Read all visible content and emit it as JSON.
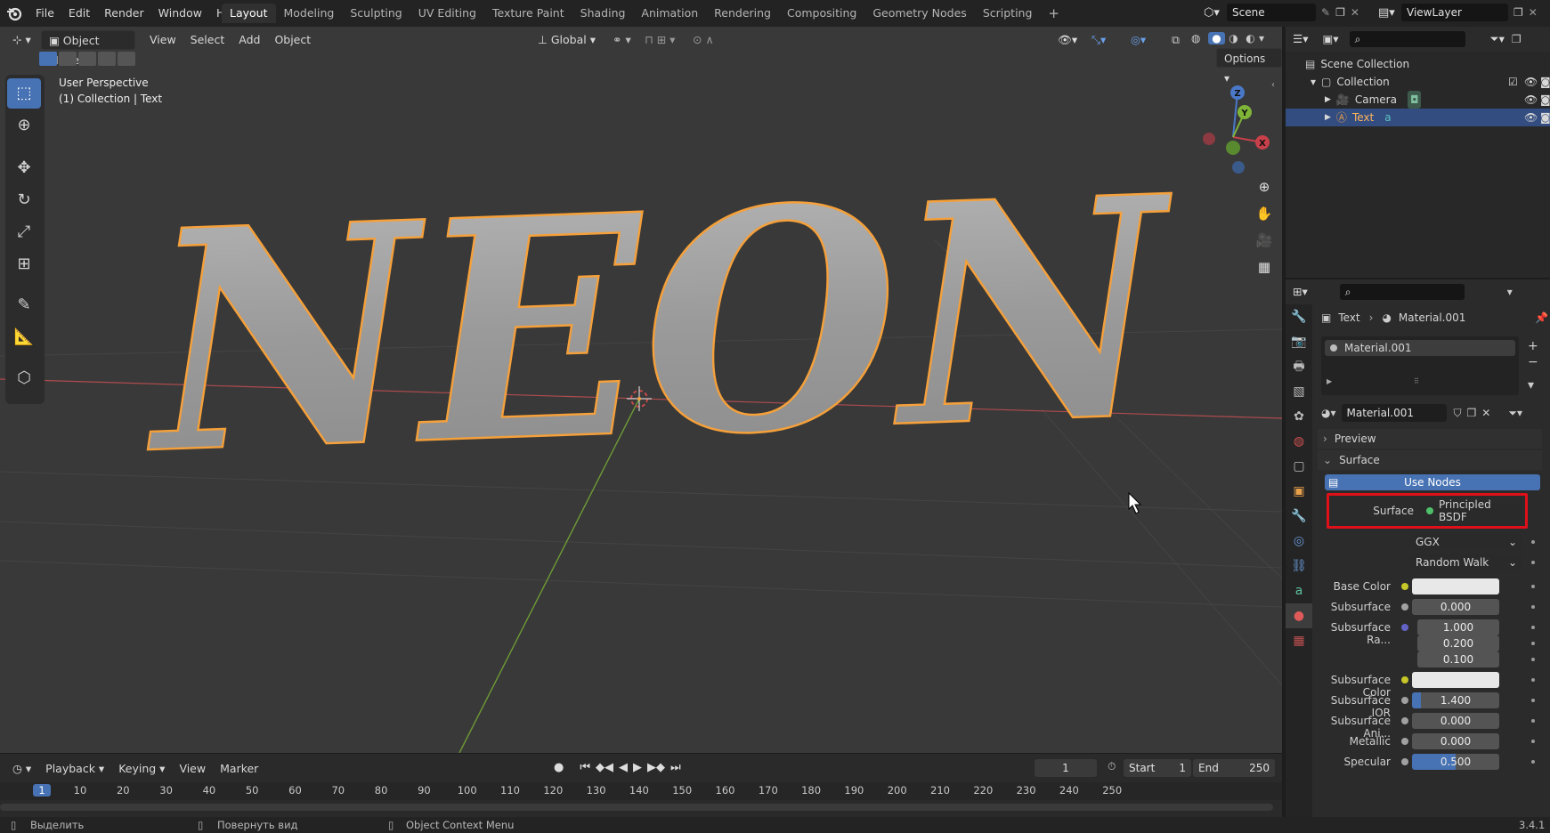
{
  "topbar": {
    "menus": [
      "File",
      "Edit",
      "Render",
      "Window",
      "Help"
    ],
    "workspaces": [
      "Layout",
      "Modeling",
      "Sculpting",
      "UV Editing",
      "Texture Paint",
      "Shading",
      "Animation",
      "Rendering",
      "Compositing",
      "Geometry Nodes",
      "Scripting"
    ],
    "active_workspace": "Layout",
    "add_tab": "+",
    "scene": "Scene",
    "view_layer": "ViewLayer"
  },
  "viewport": {
    "mode": "Object Mode",
    "menus": [
      "View",
      "Select",
      "Add",
      "Object"
    ],
    "orientation": "Global",
    "options_label": "Options",
    "info_line1": "User Perspective",
    "info_line2": "(1) Collection | Text",
    "text_object": "NEON",
    "gizmo": {
      "z": "Z",
      "y": "Y",
      "x": "X"
    }
  },
  "timeline": {
    "menus": [
      "Playback",
      "Keying",
      "View",
      "Marker"
    ],
    "current_frame": "1",
    "start_label": "Start",
    "start": "1",
    "end_label": "End",
    "end": "250",
    "ruler": [
      "1",
      "10",
      "20",
      "30",
      "40",
      "50",
      "60",
      "70",
      "80",
      "90",
      "100",
      "110",
      "120",
      "130",
      "140",
      "150",
      "160",
      "170",
      "180",
      "190",
      "200",
      "210",
      "220",
      "230",
      "240",
      "250"
    ]
  },
  "statusbar": {
    "select": "Выделить",
    "rotate": "Повернуть вид",
    "context": "Object Context Menu",
    "version": "3.4.1"
  },
  "outliner": {
    "scene_collection": "Scene Collection",
    "collection": "Collection",
    "camera": "Camera",
    "text": "Text"
  },
  "properties": {
    "breadcrumb_object": "Text",
    "breadcrumb_material": "Material.001",
    "slot_name": "Material.001",
    "material_name": "Material.001",
    "preview_label": "Preview",
    "surface_panel": "Surface",
    "use_nodes": "Use Nodes",
    "surface_label": "Surface",
    "surface_value": "Principled BSDF",
    "distribution": "GGX",
    "subsurface_method": "Random Walk",
    "rows": [
      {
        "label": "Base Color",
        "value": "",
        "dot": "#c7c729",
        "type": "color"
      },
      {
        "label": "Subsurface",
        "value": "0.000",
        "dot": "#a1a1a1",
        "type": "num"
      },
      {
        "label": "Subsurface Ra...",
        "value": "1.000",
        "dot": "#6363c7",
        "type": "num"
      },
      {
        "label": "",
        "value": "0.200",
        "type": "num"
      },
      {
        "label": "",
        "value": "0.100",
        "type": "num"
      },
      {
        "label": "Subsurface Color",
        "value": "",
        "dot": "#c7c729",
        "type": "color"
      },
      {
        "label": "Subsurface IOR",
        "value": "1.400",
        "dot": "#a1a1a1",
        "type": "num"
      },
      {
        "label": "Subsurface Ani...",
        "value": "0.000",
        "dot": "#a1a1a1",
        "type": "num"
      },
      {
        "label": "Metallic",
        "value": "0.000",
        "dot": "#a1a1a1",
        "type": "num"
      },
      {
        "label": "Specular",
        "value": "0.500",
        "dot": "#a1a1a1",
        "type": "num"
      }
    ]
  },
  "colors": {
    "accent": "#4772b3",
    "highlight_box": "#e0101a",
    "selection_outline": "#f5a03a",
    "x_axis": "#c83c46",
    "y_axis": "#7fb438"
  }
}
